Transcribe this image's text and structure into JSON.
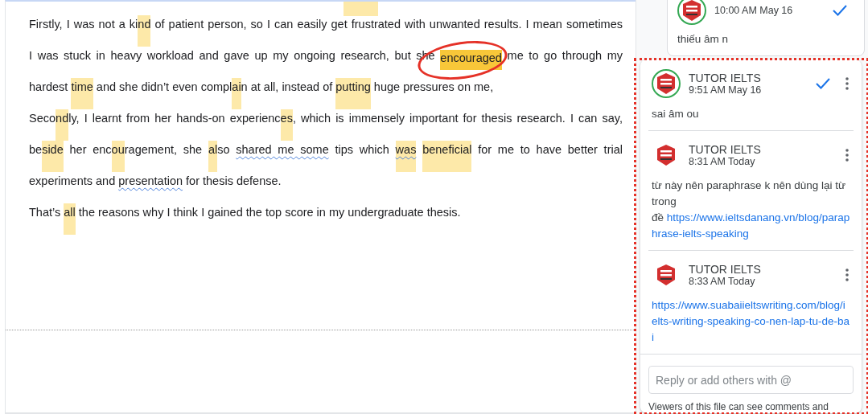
{
  "document": {
    "lines": [
      {
        "justify": true,
        "segments": [
          {
            "kind": "plain",
            "text": "Firstly, I was not a ki"
          },
          {
            "kind": "highlight",
            "text": "nd"
          },
          {
            "kind": "plain",
            "text": " of patient person, so I can easily get frustrated with unwanted results. I mean sometimes"
          }
        ]
      },
      {
        "justify": true,
        "segments": [
          {
            "kind": "plain",
            "text": "I was stuck in heavy workload and gave up my ongoing research, but she "
          },
          {
            "kind": "active",
            "text": "encouraged"
          },
          {
            "kind": "plain",
            "text": " me to go through my"
          }
        ]
      },
      {
        "justify": false,
        "segments": [
          {
            "kind": "plain",
            "text": "hardest "
          },
          {
            "kind": "highlight",
            "text": "time"
          },
          {
            "kind": "plain",
            "text": " and she didn’t even compl"
          },
          {
            "kind": "highlight",
            "text": "ai"
          },
          {
            "kind": "plain",
            "text": "n at all, instead of "
          },
          {
            "kind": "highlight",
            "text": "putting"
          },
          {
            "kind": "plain",
            "text": " huge pressures on me,"
          }
        ]
      },
      {
        "justify": true,
        "segments": [
          {
            "kind": "plain",
            "text": "Seco"
          },
          {
            "kind": "highlight",
            "text": "nd"
          },
          {
            "kind": "plain",
            "text": "ly, I learnt from her hands-on experienc"
          },
          {
            "kind": "highlight",
            "text": "es"
          },
          {
            "kind": "plain",
            "text": ", which is immensely important for thesis research. I can say,"
          }
        ]
      },
      {
        "justify": true,
        "segments": [
          {
            "kind": "plain",
            "text": "be"
          },
          {
            "kind": "highlight",
            "text": "side"
          },
          {
            "kind": "plain",
            "text": " her enc"
          },
          {
            "kind": "highlight",
            "text": "ou"
          },
          {
            "kind": "plain",
            "text": "ragement, she "
          },
          {
            "kind": "highlight",
            "text": "al"
          },
          {
            "kind": "plain",
            "text": "so "
          },
          {
            "kind": "misspelled",
            "text": "shared me some"
          },
          {
            "kind": "plain",
            "text": " tips which "
          },
          {
            "kind": "highlight-misspelled",
            "text": "was"
          },
          {
            "kind": "highlight",
            "text": "beneficial"
          },
          {
            "kind": "plain",
            "text": " for me to have better trial"
          }
        ]
      },
      {
        "justify": false,
        "segments": [
          {
            "kind": "plain",
            "text": "experiments and "
          },
          {
            "kind": "misspelled",
            "text": "presentation"
          },
          {
            "kind": "plain",
            "text": " for thesis defense."
          }
        ]
      },
      {
        "justify": false,
        "segments": [
          {
            "kind": "plain",
            "text": "That’s "
          },
          {
            "kind": "highlight",
            "text": "all"
          },
          {
            "kind": "plain",
            "text": " the reasons why I think I gained the top score in my undergraduate thesis."
          }
        ]
      }
    ]
  },
  "comments_pane": {
    "previous_card": {
      "time": "10:00 AM May 16",
      "avatar_ring": true,
      "resolve": true,
      "text": "thiếu âm n"
    },
    "active_thread": {
      "comments": [
        {
          "author": "TUTOR IELTS",
          "time": "9:51 AM May 16",
          "avatar_ring": true,
          "resolve": true,
          "paragraphs": [
            [
              {
                "kind": "text",
                "text": "sai âm ou"
              }
            ]
          ]
        },
        {
          "author": "TUTOR IELTS",
          "time": "8:31 AM Today",
          "avatar_ring": false,
          "resolve": false,
          "paragraphs": [
            [
              {
                "kind": "text",
                "text": "từ này nên paraphrase k nên dùng lại từ trong"
              }
            ],
            [
              {
                "kind": "text",
                "text": "đề "
              },
              {
                "kind": "link",
                "text": "https://www.ieltsdanang.vn/blog/paraphrase-ielts-speaking"
              }
            ]
          ]
        },
        {
          "author": "TUTOR IELTS",
          "time": "8:33 AM Today",
          "avatar_ring": false,
          "resolve": false,
          "paragraphs": [
            [
              {
                "kind": "link",
                "text": "https://www.suabaiieltswriting.com/blog/ielts-writing-speaking-co-nen-lap-tu-de-bai"
              }
            ]
          ]
        }
      ],
      "reply": {
        "placeholder": "Reply or add others with @"
      },
      "footer": "Viewers of this file can see comments and"
    }
  }
}
